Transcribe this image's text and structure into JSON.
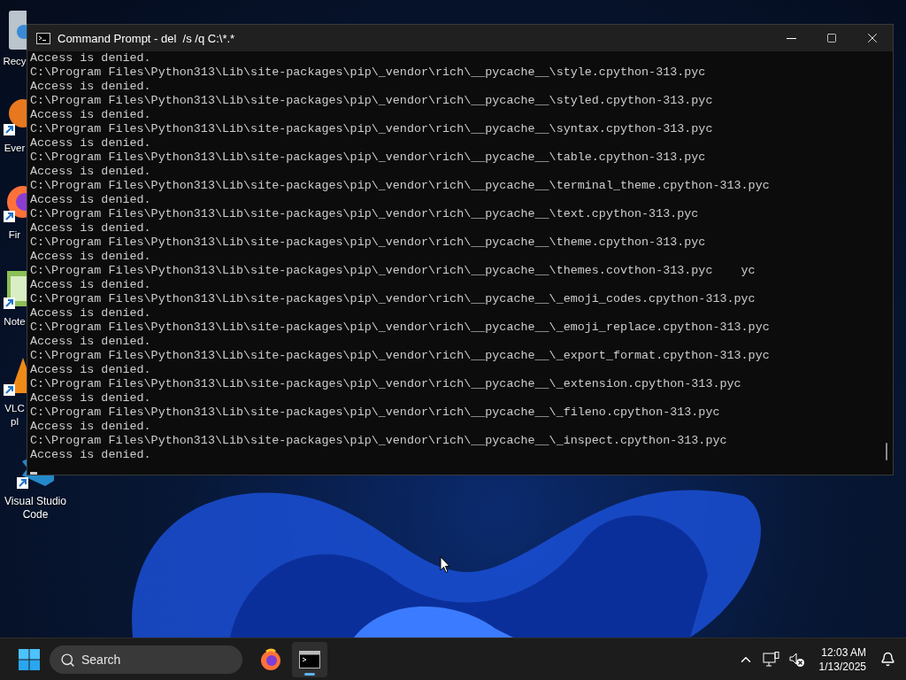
{
  "desktop_icons": [
    {
      "kind": "recycle-bin",
      "label": "Recy"
    },
    {
      "kind": "everything",
      "label": "Ever"
    },
    {
      "kind": "firefox",
      "label": "Fir"
    },
    {
      "kind": "notepad",
      "label": "Note"
    },
    {
      "kind": "vlc",
      "label": "VLC\npl"
    },
    {
      "kind": "vscode",
      "label": "Visual Studio Code"
    }
  ],
  "window": {
    "title": "Command Prompt - del  /s /q C:\\*.*",
    "lines": [
      "Access is denied.",
      "C:\\Program Files\\Python313\\Lib\\site-packages\\pip\\_vendor\\rich\\__pycache__\\style.cpython-313.pyc",
      "Access is denied.",
      "C:\\Program Files\\Python313\\Lib\\site-packages\\pip\\_vendor\\rich\\__pycache__\\styled.cpython-313.pyc",
      "Access is denied.",
      "C:\\Program Files\\Python313\\Lib\\site-packages\\pip\\_vendor\\rich\\__pycache__\\syntax.cpython-313.pyc",
      "Access is denied.",
      "C:\\Program Files\\Python313\\Lib\\site-packages\\pip\\_vendor\\rich\\__pycache__\\table.cpython-313.pyc",
      "Access is denied.",
      "C:\\Program Files\\Python313\\Lib\\site-packages\\pip\\_vendor\\rich\\__pycache__\\terminal_theme.cpython-313.pyc",
      "Access is denied.",
      "C:\\Program Files\\Python313\\Lib\\site-packages\\pip\\_vendor\\rich\\__pycache__\\text.cpython-313.pyc",
      "Access is denied.",
      "C:\\Program Files\\Python313\\Lib\\site-packages\\pip\\_vendor\\rich\\__pycache__\\theme.cpython-313.pyc",
      "Access is denied.",
      "C:\\Program Files\\Python313\\Lib\\site-packages\\pip\\_vendor\\rich\\__pycache__\\themes.covthon-313.pyc    yc",
      "Access is denied.",
      "C:\\Program Files\\Python313\\Lib\\site-packages\\pip\\_vendor\\rich\\__pycache__\\_emoji_codes.cpython-313.pyc",
      "Access is denied.",
      "C:\\Program Files\\Python313\\Lib\\site-packages\\pip\\_vendor\\rich\\__pycache__\\_emoji_replace.cpython-313.pyc",
      "Access is denied.",
      "C:\\Program Files\\Python313\\Lib\\site-packages\\pip\\_vendor\\rich\\__pycache__\\_export_format.cpython-313.pyc",
      "Access is denied.",
      "C:\\Program Files\\Python313\\Lib\\site-packages\\pip\\_vendor\\rich\\__pycache__\\_extension.cpython-313.pyc",
      "Access is denied.",
      "C:\\Program Files\\Python313\\Lib\\site-packages\\pip\\_vendor\\rich\\__pycache__\\_fileno.cpython-313.pyc",
      "Access is denied.",
      "C:\\Program Files\\Python313\\Lib\\site-packages\\pip\\_vendor\\rich\\__pycache__\\_inspect.cpython-313.pyc",
      "Access is denied."
    ]
  },
  "taskbar": {
    "search": {
      "placeholder": "Search"
    },
    "apps": [
      {
        "kind": "firefox",
        "selected": false
      },
      {
        "kind": "terminal",
        "selected": true
      }
    ],
    "clock": {
      "time": "12:03 AM",
      "date": "1/13/2025"
    }
  }
}
